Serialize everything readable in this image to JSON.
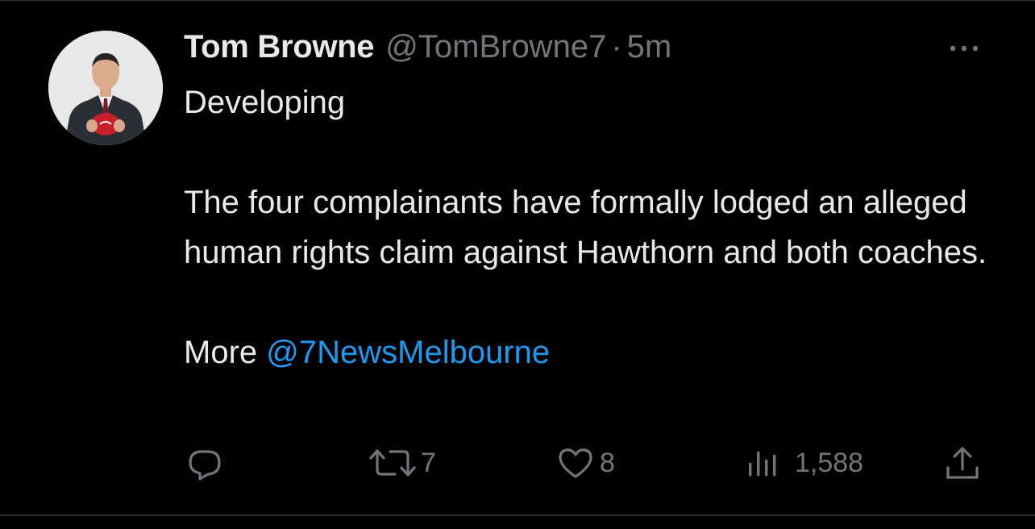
{
  "author": {
    "display_name": "Tom Browne",
    "handle": "@TomBrowne7",
    "separator": "·",
    "timestamp": "5m"
  },
  "tweet": {
    "line1": "Developing",
    "paragraph": "The four complainants have formally lodged an alleged human rights claim against Hawthorn and both coaches.",
    "more_label": "More ",
    "mention": "@7NewsMelbourne"
  },
  "actions": {
    "reply_icon": "reply-icon",
    "retweet_icon": "retweet-icon",
    "retweet_count": "7",
    "like_icon": "heart-icon",
    "like_count": "8",
    "views_icon": "views-bar-chart-icon",
    "views_count": "1,588",
    "share_icon": "share-upload-icon"
  },
  "colors": {
    "background": "#000000",
    "primary_text": "#e7e9ea",
    "secondary_text": "#71767b",
    "link": "#1d9bf0",
    "border": "#2f3336"
  }
}
